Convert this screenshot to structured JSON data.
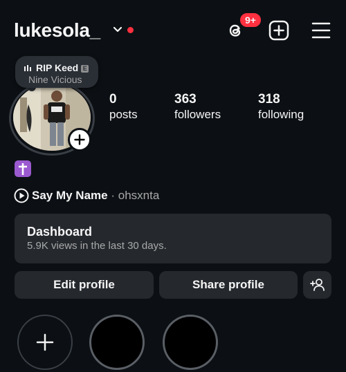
{
  "header": {
    "username": "lukesola_",
    "notification_count": "9+"
  },
  "profile": {
    "note": {
      "song": "RIP Keed",
      "explicit_label": "E",
      "artist": "Nine Vicious"
    },
    "stats": [
      {
        "value": "0",
        "label": "posts"
      },
      {
        "value": "363",
        "label": "followers"
      },
      {
        "value": "318",
        "label": "following"
      }
    ],
    "bio_emoji": "✝️",
    "music": {
      "title": "Say My Name",
      "separator": " · ",
      "artist": "ohsxnta"
    }
  },
  "dashboard": {
    "title": "Dashboard",
    "subtitle": "5.9K views in the last 30 days."
  },
  "buttons": {
    "edit": "Edit profile",
    "share": "Share profile"
  },
  "colors": {
    "background": "#0c1014",
    "surface": "#25292e",
    "badge": "#ff3040",
    "secondary_text": "#a8a8a8"
  },
  "icons": [
    "chevron-down-icon",
    "threads-icon",
    "create-icon",
    "menu-icon",
    "add-icon",
    "play-icon",
    "add-user-icon",
    "audio-bars-icon"
  ]
}
